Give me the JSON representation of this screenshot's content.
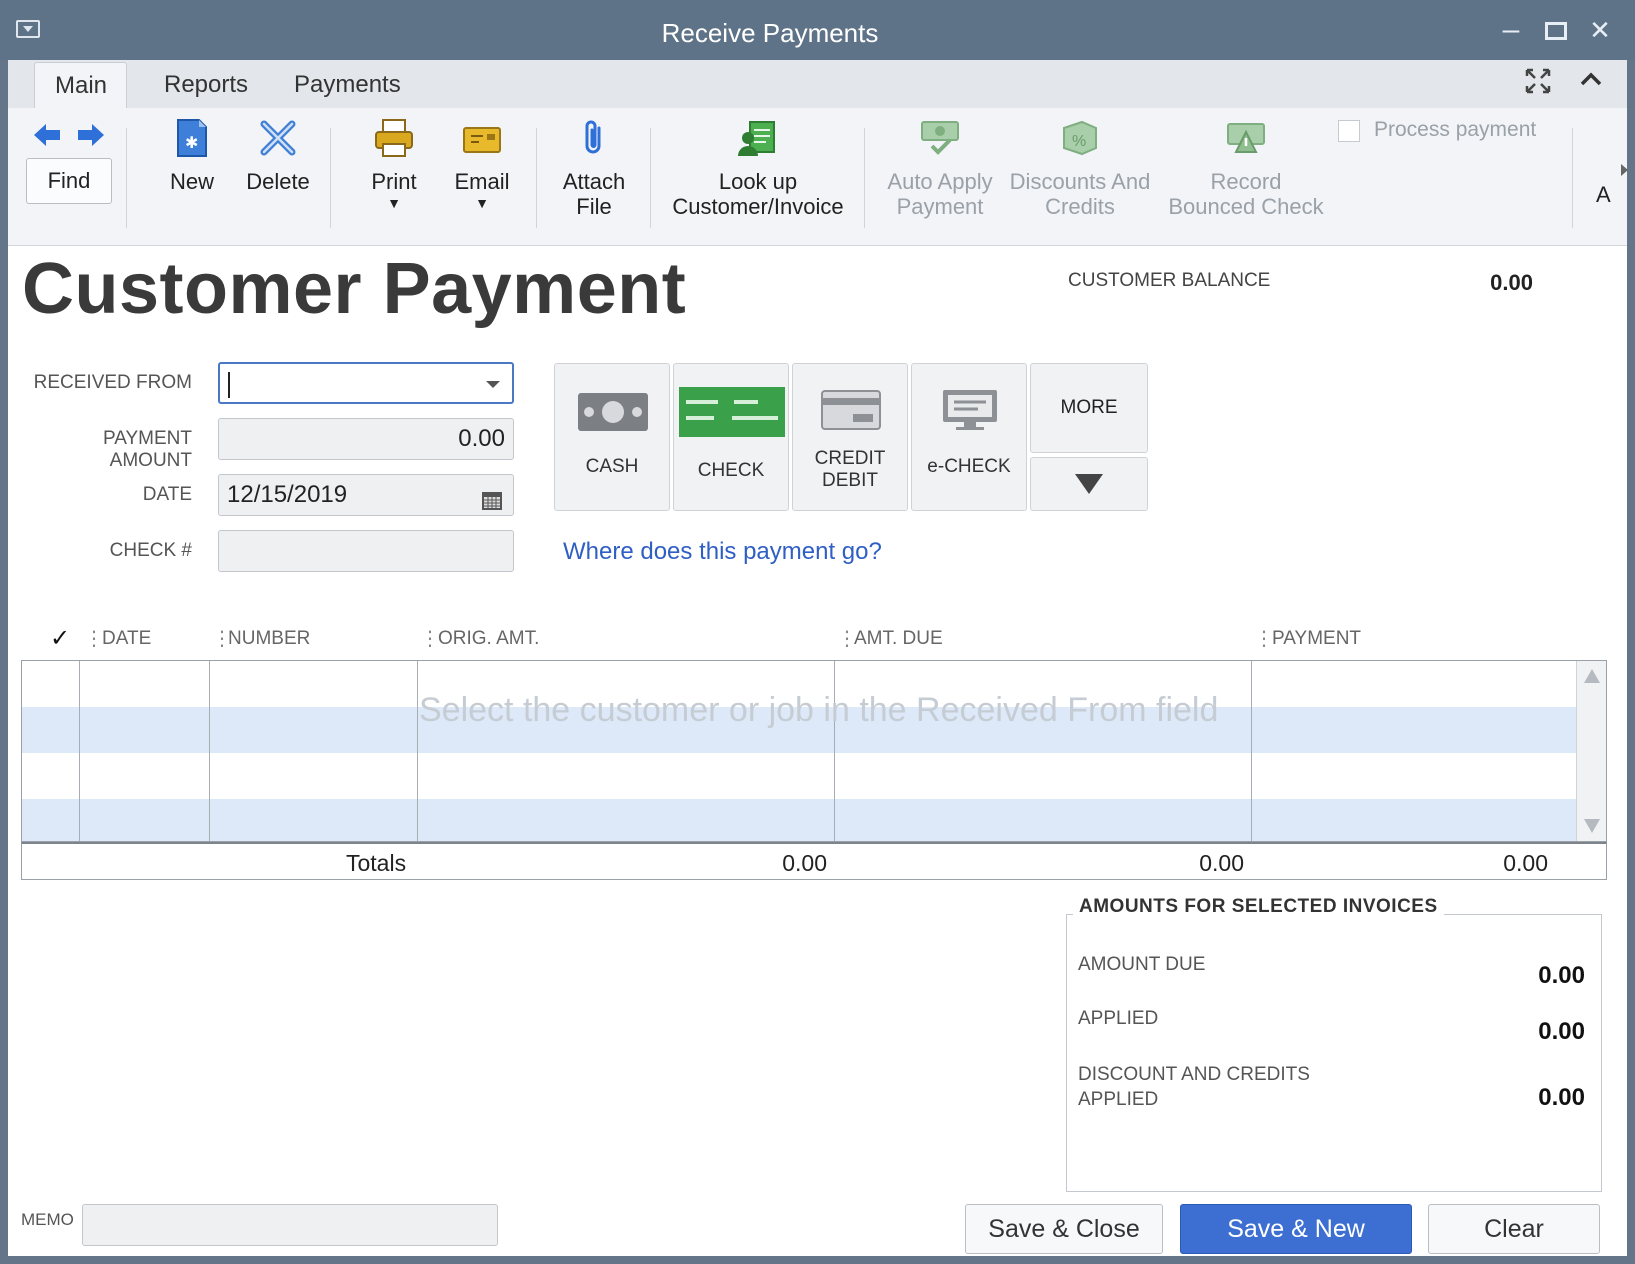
{
  "window": {
    "title": "Receive Payments"
  },
  "tabs": [
    "Main",
    "Reports",
    "Payments"
  ],
  "toolbar": {
    "find": "Find",
    "new": "New",
    "delete": "Delete",
    "print": "Print",
    "email": "Email",
    "attach_line1": "Attach",
    "attach_line2": "File",
    "lookup_line1": "Look up",
    "lookup_line2": "Customer/Invoice",
    "auto_apply_line1": "Auto Apply",
    "auto_apply_line2": "Payment",
    "discounts_line1": "Discounts And",
    "discounts_line2": "Credits",
    "bounced_line1": "Record",
    "bounced_line2": "Bounced Check",
    "process_payment": "Process payment",
    "overflow_text": "A"
  },
  "header": {
    "title": "Customer Payment",
    "balance_label": "CUSTOMER BALANCE",
    "balance_value": "0.00"
  },
  "form": {
    "received_from_label": "RECEIVED FROM",
    "received_from_value": "",
    "payment_amount_label": "PAYMENT AMOUNT",
    "payment_amount_value": "0.00",
    "date_label": "DATE",
    "date_value": "12/15/2019",
    "check_label": "CHECK #",
    "check_value": ""
  },
  "payment_methods": {
    "cash": "CASH",
    "check": "CHECK",
    "credit_line1": "CREDIT",
    "credit_line2": "DEBIT",
    "echeck": "e-CHECK",
    "more": "MORE"
  },
  "help_link": "Where does this payment go?",
  "grid": {
    "check_header": "✓",
    "columns": [
      "DATE",
      "NUMBER",
      "ORIG. AMT.",
      "AMT. DUE",
      "PAYMENT"
    ],
    "hint": "Select the customer or job in the Received From field",
    "totals_label": "Totals",
    "totals": {
      "orig_amt": "0.00",
      "amt_due": "0.00",
      "payment": "0.00"
    }
  },
  "amounts": {
    "title": "AMOUNTS FOR SELECTED INVOICES",
    "amount_due_label": "AMOUNT DUE",
    "amount_due_value": "0.00",
    "applied_label": "APPLIED",
    "applied_value": "0.00",
    "discount_line1": "DISCOUNT AND CREDITS",
    "discount_line2": "APPLIED",
    "discount_value": "0.00"
  },
  "footer": {
    "memo_label": "MEMO",
    "memo_value": "",
    "save_close": "Save & Close",
    "save_new": "Save & New",
    "clear": "Clear"
  },
  "colors": {
    "titlebar": "#5f7388",
    "primary_button": "#3c6fd1",
    "link": "#2f5fc4",
    "check_green": "#3aa14a",
    "row_alt": "#dde9f8"
  }
}
